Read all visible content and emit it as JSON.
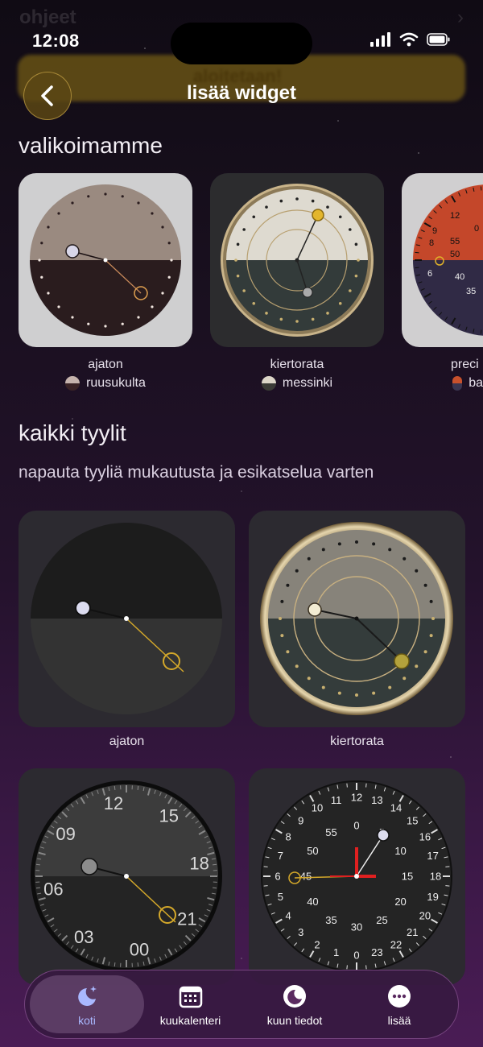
{
  "status_bar": {
    "time": "12:08"
  },
  "background_ghost": {
    "title": "ohjeet",
    "banner": "aloitetaan!"
  },
  "header": {
    "title": "lisää widget"
  },
  "featured": {
    "title": "valikoimamme",
    "items": [
      {
        "name": "ajaton",
        "variant": "ruusukulta",
        "swatch_colors": [
          "#c6b3ad",
          "#3a2326"
        ]
      },
      {
        "name": "kiertorata",
        "variant": "messinki",
        "swatch_colors": [
          "#dcd6c8",
          "#3a3b36"
        ]
      },
      {
        "name": "preci",
        "variant": "ba",
        "swatch_colors": [
          "#c8512c",
          "#3a3550"
        ]
      }
    ]
  },
  "all_styles": {
    "title": "kaikki tyylit",
    "subtitle": "napauta tyyliä mukautusta ja esikatselua varten",
    "items": [
      {
        "name": "ajaton"
      },
      {
        "name": "kiertorata"
      },
      {
        "name": ""
      },
      {
        "name": ""
      }
    ]
  },
  "dial_labels": {
    "compact_hours": [
      "12",
      "15",
      "18",
      "21",
      "00",
      "03",
      "06",
      "09"
    ],
    "minutes": [
      "55",
      "0",
      "5",
      "10",
      "15",
      "20",
      "25",
      "30",
      "35",
      "40",
      "45",
      "50"
    ],
    "hours24": [
      "13",
      "14",
      "15",
      "16",
      "17",
      "18",
      "19",
      "20",
      "21",
      "22",
      "23",
      "0",
      "1",
      "2",
      "3",
      "4",
      "5",
      "6",
      "7",
      "8",
      "9",
      "10",
      "11",
      "12"
    ]
  },
  "tabs": [
    {
      "label": "koti",
      "icon": "moon-stars-icon",
      "active": true
    },
    {
      "label": "kuukalenteri",
      "icon": "calendar-icon",
      "active": false
    },
    {
      "label": "kuun tiedot",
      "icon": "moon-icon",
      "active": false
    },
    {
      "label": "lisää",
      "icon": "more-icon",
      "active": false
    }
  ],
  "colors": {
    "accent": "#a9b8ff",
    "gold": "#e0b22a",
    "back_button": "#5a4614"
  }
}
